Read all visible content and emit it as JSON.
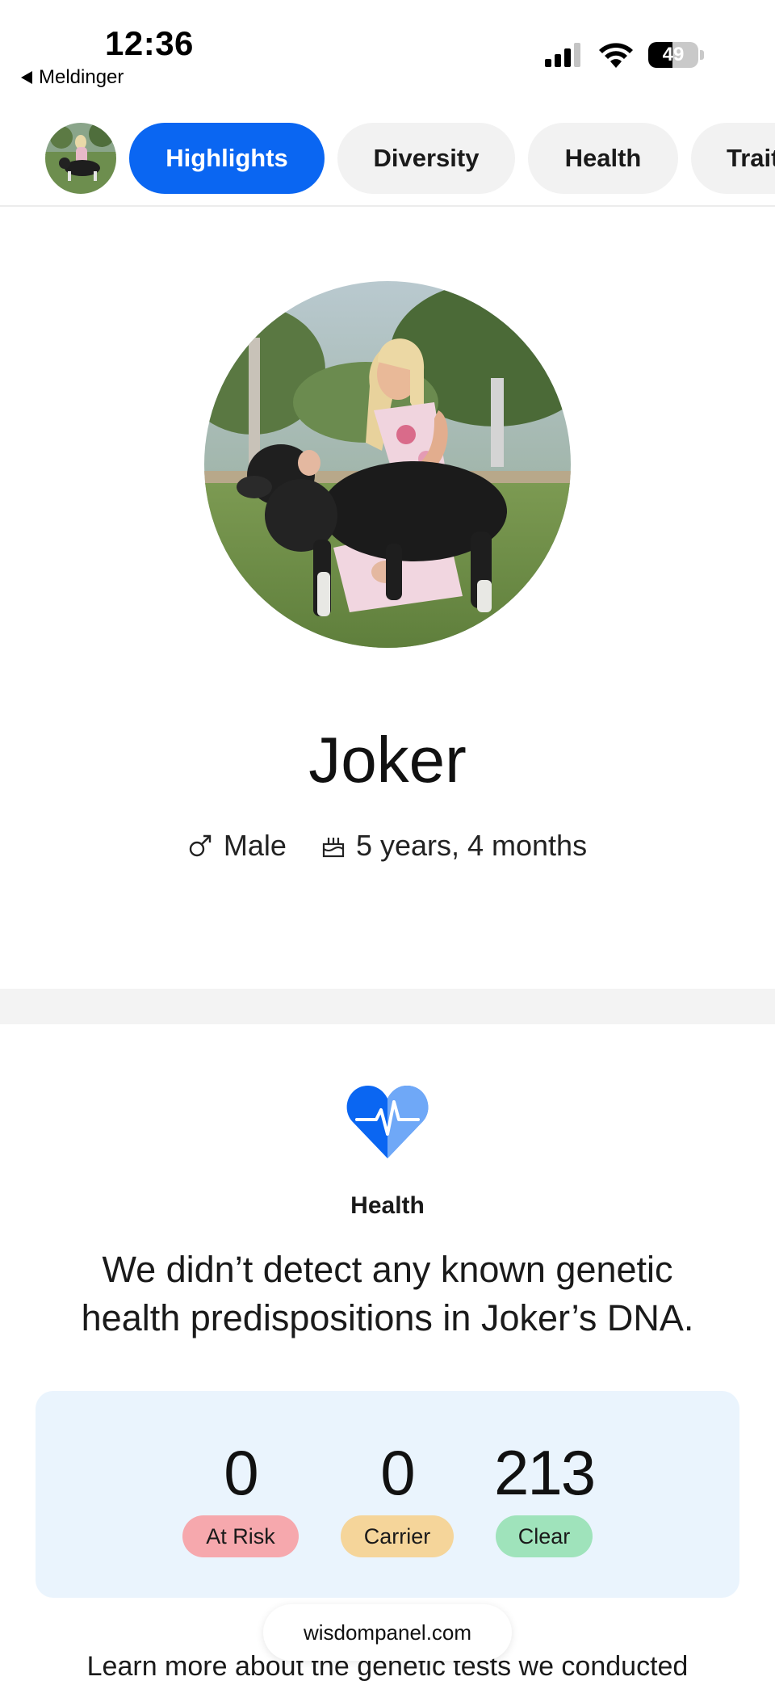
{
  "status_bar": {
    "time": "12:36",
    "back_label": "Meldinger",
    "battery_level": "49",
    "battery_fraction": 0.49
  },
  "tabs": [
    {
      "label": "Highlights",
      "active": true
    },
    {
      "label": "Diversity",
      "active": false
    },
    {
      "label": "Health",
      "active": false
    },
    {
      "label": "Trait",
      "active": false
    }
  ],
  "profile": {
    "name": "Joker",
    "sex": "Male",
    "age": "5 years, 4 months"
  },
  "health": {
    "title": "Health",
    "message": "We didn’t detect any known genetic health predispositions in Joker’s DNA.",
    "stats": [
      {
        "value": "0",
        "label": "At Risk",
        "color": "#f6a8ad"
      },
      {
        "value": "0",
        "label": "Carrier",
        "color": "#f5d59a"
      },
      {
        "value": "213",
        "label": "Clear",
        "color": "#9fe3bb"
      }
    ]
  },
  "browser": {
    "url": "wisdompanel.com"
  },
  "footer": {
    "learn_more": "Learn more about the genetic tests we conducted"
  },
  "colors": {
    "accent": "#0a66f2",
    "heart_dark": "#0a66f2",
    "heart_light": "#6fa8f7",
    "card_bg": "#eaf4fd"
  }
}
